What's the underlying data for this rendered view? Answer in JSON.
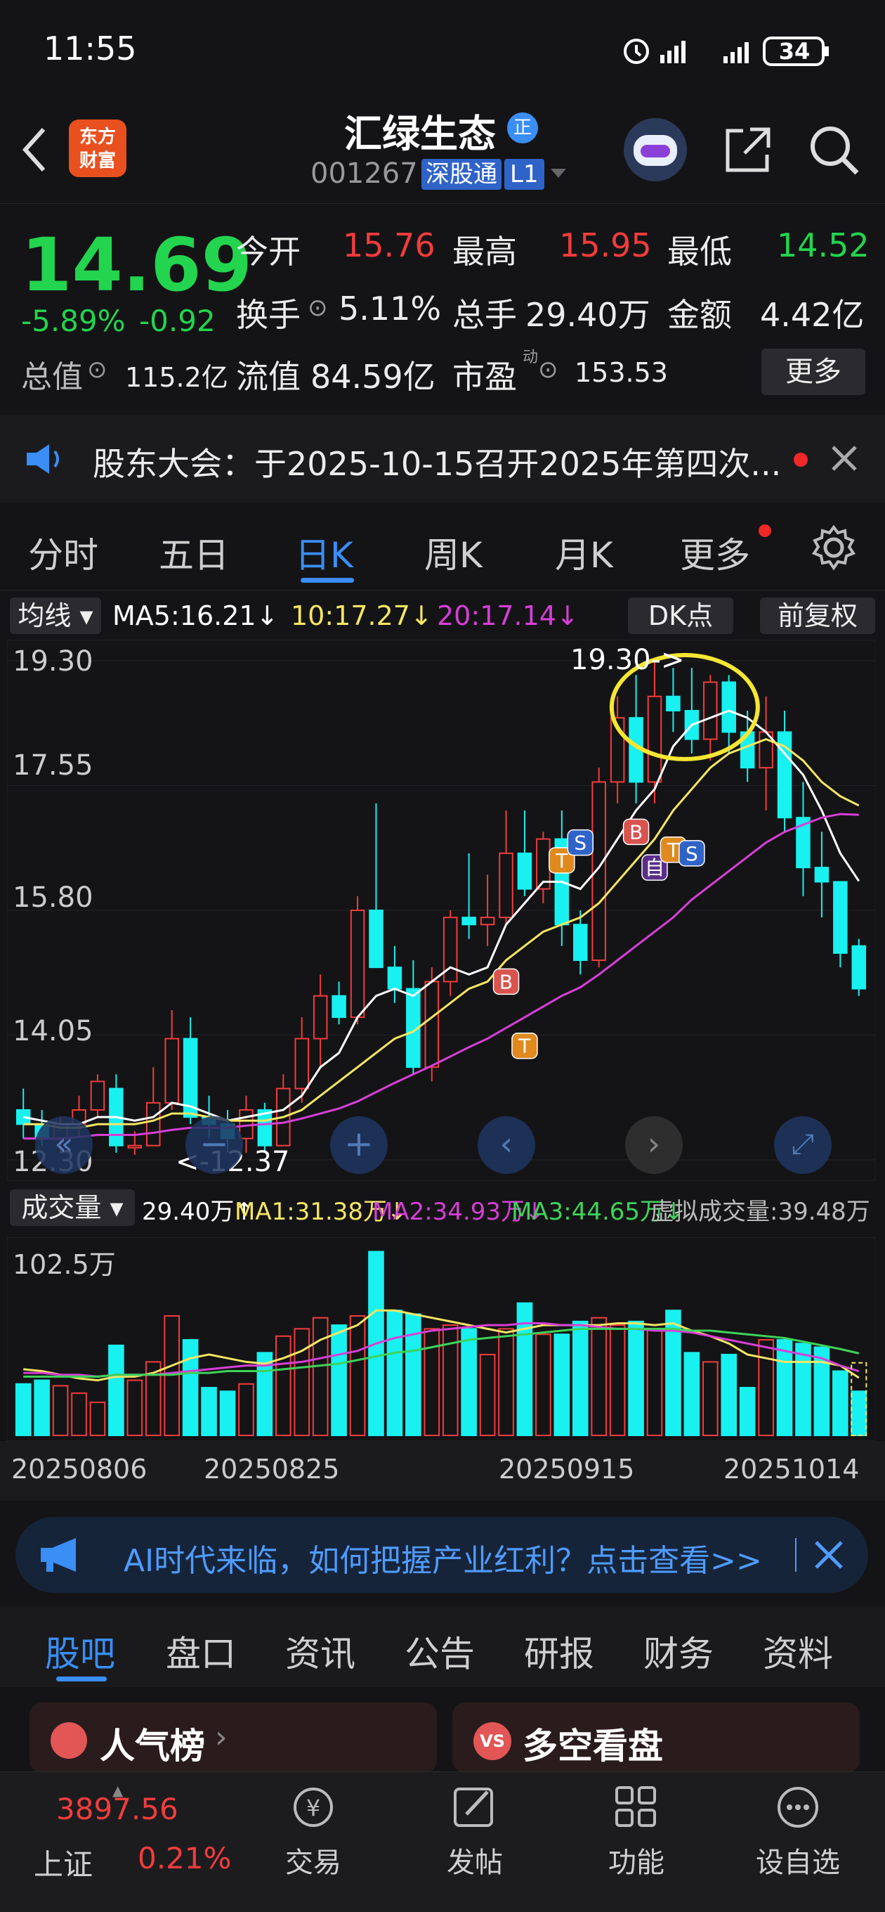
{
  "status": {
    "time": "11:55",
    "battery": "34"
  },
  "header": {
    "logo_line1": "东方",
    "logo_line2": "财富",
    "title": "汇绿生态",
    "title_badge": "正",
    "code": "001267",
    "tag_connect": "深股通",
    "tag_level": "L1"
  },
  "quote": {
    "price": "14.69",
    "change_pct": "-5.89%",
    "change_amt": "-0.92",
    "open_label": "今开",
    "open": "15.76",
    "high_label": "最高",
    "high": "15.95",
    "low_label": "最低",
    "low": "14.52",
    "turnover_label": "换手",
    "turnover": "5.11%",
    "volume_label": "总手",
    "volume": "29.40万",
    "amount_label": "金额",
    "amount": "4.42亿",
    "mktcap_label": "总值",
    "mktcap": "115.2亿",
    "float_label": "流值",
    "float_cap": "84.59亿",
    "pe_label": "市盈",
    "pe_sup": "动",
    "pe": "153.53",
    "more_button": "更多"
  },
  "notice": {
    "text": "股东大会：于2025-10-15召开2025年第四次..."
  },
  "ktabs": [
    "分时",
    "五日",
    "日K",
    "周K",
    "月K",
    "更多"
  ],
  "ktab_active": "日K",
  "chart_toolbar": {
    "ma_select": "均线",
    "ma5": "MA5:16.21↓",
    "ma10": "10:17.27↓",
    "ma20": "20:17.14↓",
    "dk_button": "DK点",
    "adjust_button": "前复权"
  },
  "price_axis": [
    "19.30",
    "17.55",
    "15.80",
    "14.05",
    "12.30"
  ],
  "annotations": {
    "high_marker": "19.30->",
    "low_marker": "<-12.37",
    "signal_b": "B",
    "signal_s": "S",
    "signal_t": "T",
    "signal_self": "自"
  },
  "volume_toolbar": {
    "select": "成交量",
    "vol": "29.40万↑",
    "ma1": "MA1:31.38万↓",
    "ma2": "MA2:34.93万↓",
    "ma3": "MA3:44.65万↓",
    "virtual": "虚拟成交量:39.48万"
  },
  "volume_axis_top": "102.5万",
  "date_axis": [
    "20250806",
    "20250825",
    "20250915",
    "20251014"
  ],
  "ad": {
    "text": "AI时代来临，如何把握产业红利？点击查看>>"
  },
  "subtabs": [
    "股吧",
    "盘口",
    "资讯",
    "公告",
    "研报",
    "财务",
    "资料"
  ],
  "subtab_active": "股吧",
  "cards": {
    "left": "人气榜",
    "right": "多空看盘",
    "right_icon": "VS"
  },
  "bottomnav": {
    "index_value": "3897.56",
    "index_name": "上证",
    "index_change": "0.21%",
    "items": [
      "交易",
      "发帖",
      "功能",
      "设自选"
    ]
  },
  "colors": {
    "up": "#f23c3c",
    "down": "#19f0f0",
    "ma5": "#ffffff",
    "ma10": "#f5e663",
    "ma20": "#d63fd6",
    "accent": "#3a8ef6"
  },
  "chart_data": {
    "type": "candlestick",
    "ylim": [
      12.3,
      19.3
    ],
    "candles": [
      {
        "o": 13.0,
        "h": 13.3,
        "l": 12.6,
        "c": 12.8
      },
      {
        "o": 12.8,
        "h": 13.0,
        "l": 12.5,
        "c": 12.6
      },
      {
        "o": 12.6,
        "h": 12.9,
        "l": 12.4,
        "c": 12.8
      },
      {
        "o": 12.8,
        "h": 13.2,
        "l": 12.6,
        "c": 13.0
      },
      {
        "o": 13.0,
        "h": 13.5,
        "l": 12.9,
        "c": 13.4
      },
      {
        "o": 13.3,
        "h": 13.5,
        "l": 12.4,
        "c": 12.5
      },
      {
        "o": 12.5,
        "h": 12.7,
        "l": 12.37,
        "c": 12.5
      },
      {
        "o": 12.5,
        "h": 13.6,
        "l": 12.5,
        "c": 13.1
      },
      {
        "o": 13.1,
        "h": 14.4,
        "l": 13.0,
        "c": 14.0
      },
      {
        "o": 14.0,
        "h": 14.3,
        "l": 12.8,
        "c": 12.9
      },
      {
        "o": 12.9,
        "h": 13.2,
        "l": 12.6,
        "c": 12.8
      },
      {
        "o": 12.8,
        "h": 13.0,
        "l": 12.4,
        "c": 12.6
      },
      {
        "o": 12.6,
        "h": 13.2,
        "l": 12.4,
        "c": 13.0
      },
      {
        "o": 13.0,
        "h": 13.1,
        "l": 12.4,
        "c": 12.5
      },
      {
        "o": 12.5,
        "h": 13.5,
        "l": 12.5,
        "c": 13.3
      },
      {
        "o": 13.3,
        "h": 14.3,
        "l": 13.1,
        "c": 14.0
      },
      {
        "o": 14.0,
        "h": 14.9,
        "l": 13.6,
        "c": 14.6
      },
      {
        "o": 14.6,
        "h": 14.8,
        "l": 14.2,
        "c": 14.3
      },
      {
        "o": 14.3,
        "h": 16.0,
        "l": 14.2,
        "c": 15.8
      },
      {
        "o": 15.8,
        "h": 17.3,
        "l": 15.0,
        "c": 15.0
      },
      {
        "o": 15.0,
        "h": 15.3,
        "l": 14.5,
        "c": 14.7
      },
      {
        "o": 14.7,
        "h": 15.1,
        "l": 13.5,
        "c": 13.6
      },
      {
        "o": 13.6,
        "h": 15.0,
        "l": 13.4,
        "c": 14.8
      },
      {
        "o": 14.8,
        "h": 15.8,
        "l": 14.6,
        "c": 15.7
      },
      {
        "o": 15.7,
        "h": 16.6,
        "l": 15.4,
        "c": 15.6
      },
      {
        "o": 15.6,
        "h": 16.3,
        "l": 15.3,
        "c": 15.7
      },
      {
        "o": 15.7,
        "h": 17.2,
        "l": 15.6,
        "c": 16.6
      },
      {
        "o": 16.6,
        "h": 17.2,
        "l": 16.0,
        "c": 16.1
      },
      {
        "o": 16.1,
        "h": 16.9,
        "l": 15.9,
        "c": 16.8
      },
      {
        "o": 16.8,
        "h": 17.2,
        "l": 15.3,
        "c": 15.6
      },
      {
        "o": 15.6,
        "h": 15.8,
        "l": 14.9,
        "c": 15.1
      },
      {
        "o": 15.1,
        "h": 17.8,
        "l": 15.0,
        "c": 17.6
      },
      {
        "o": 17.6,
        "h": 18.8,
        "l": 17.3,
        "c": 18.5
      },
      {
        "o": 18.5,
        "h": 19.1,
        "l": 17.3,
        "c": 17.6
      },
      {
        "o": 17.6,
        "h": 19.3,
        "l": 17.3,
        "c": 18.8
      },
      {
        "o": 18.8,
        "h": 19.2,
        "l": 18.3,
        "c": 18.6
      },
      {
        "o": 18.6,
        "h": 19.2,
        "l": 18.0,
        "c": 18.2
      },
      {
        "o": 18.2,
        "h": 19.1,
        "l": 17.9,
        "c": 19.0
      },
      {
        "o": 19.0,
        "h": 19.1,
        "l": 18.0,
        "c": 18.3
      },
      {
        "o": 18.3,
        "h": 18.6,
        "l": 17.6,
        "c": 17.8
      },
      {
        "o": 17.8,
        "h": 18.8,
        "l": 17.2,
        "c": 18.3
      },
      {
        "o": 18.3,
        "h": 18.6,
        "l": 16.9,
        "c": 17.1
      },
      {
        "o": 17.1,
        "h": 17.6,
        "l": 16.0,
        "c": 16.4
      },
      {
        "o": 16.4,
        "h": 16.9,
        "l": 15.7,
        "c": 16.2
      },
      {
        "o": 16.2,
        "h": 16.2,
        "l": 15.0,
        "c": 15.2
      },
      {
        "o": 15.3,
        "h": 15.4,
        "l": 14.6,
        "c": 14.7
      }
    ],
    "ma5": [
      12.9,
      12.85,
      12.8,
      12.8,
      12.9,
      12.9,
      12.85,
      12.9,
      13.1,
      13.05,
      12.95,
      12.85,
      12.9,
      12.95,
      13.0,
      13.2,
      13.6,
      13.8,
      14.3,
      14.6,
      14.7,
      14.6,
      14.8,
      15.0,
      14.9,
      15.0,
      15.6,
      15.9,
      16.2,
      16.2,
      16.1,
      16.4,
      16.8,
      17.2,
      17.5,
      18.1,
      18.4,
      18.5,
      18.6,
      18.5,
      18.3,
      18.0,
      17.7,
      17.2,
      16.6,
      16.21
    ],
    "ma10": [
      12.8,
      12.8,
      12.75,
      12.75,
      12.8,
      12.8,
      12.8,
      12.85,
      12.95,
      12.95,
      12.9,
      12.85,
      12.85,
      12.85,
      12.9,
      13.0,
      13.2,
      13.4,
      13.6,
      13.8,
      14.0,
      14.1,
      14.3,
      14.5,
      14.7,
      14.8,
      15.1,
      15.3,
      15.5,
      15.6,
      15.7,
      15.9,
      16.2,
      16.5,
      16.8,
      17.2,
      17.5,
      17.8,
      18.0,
      18.1,
      18.2,
      18.1,
      17.9,
      17.6,
      17.4,
      17.27
    ],
    "ma20": [
      12.6,
      12.6,
      12.6,
      12.62,
      12.65,
      12.65,
      12.65,
      12.68,
      12.72,
      12.75,
      12.75,
      12.75,
      12.78,
      12.8,
      12.82,
      12.88,
      12.95,
      13.02,
      13.12,
      13.25,
      13.38,
      13.5,
      13.62,
      13.75,
      13.88,
      14.0,
      14.15,
      14.3,
      14.45,
      14.6,
      14.72,
      14.9,
      15.1,
      15.3,
      15.5,
      15.7,
      15.95,
      16.15,
      16.35,
      16.55,
      16.75,
      16.9,
      17.0,
      17.1,
      17.15,
      17.14
    ],
    "volumes": [
      28,
      30,
      27,
      23,
      18,
      49,
      30,
      40,
      65,
      52,
      26,
      24,
      28,
      45,
      54,
      58,
      64,
      60,
      65,
      100,
      68,
      66,
      58,
      60,
      58,
      44,
      58,
      72,
      55,
      55,
      62,
      64,
      60,
      62,
      58,
      68,
      45,
      40,
      44,
      26,
      52,
      52,
      50,
      48,
      35,
      24
    ],
    "vol_ma1": [
      36,
      35,
      33,
      31,
      30,
      32,
      32,
      34,
      38,
      42,
      44,
      42,
      40,
      39,
      42,
      46,
      52,
      56,
      60,
      68,
      68,
      66,
      64,
      62,
      60,
      58,
      56,
      58,
      60,
      60,
      60,
      60,
      61,
      61,
      60,
      61,
      57,
      54,
      50,
      44,
      42,
      40,
      40,
      40,
      38,
      31.38
    ],
    "vol_ma2": [
      34,
      34,
      33,
      33,
      32,
      33,
      33,
      33,
      34,
      35,
      36,
      37,
      38,
      38,
      39,
      40,
      42,
      44,
      46,
      50,
      53,
      55,
      57,
      58,
      59,
      60,
      60,
      61,
      61,
      60,
      60,
      59,
      58,
      58,
      57,
      57,
      56,
      54,
      52,
      50,
      48,
      46,
      44,
      42,
      38,
      34.93
    ],
    "vol_ma3": [
      32,
      32,
      32,
      32,
      32,
      33,
      33,
      33,
      33,
      34,
      34,
      35,
      35,
      35,
      36,
      37,
      38,
      39,
      41,
      43,
      45,
      46,
      48,
      50,
      52,
      53,
      54,
      55,
      56,
      57,
      58,
      58,
      58,
      58,
      58,
      58,
      57,
      57,
      56,
      55,
      54,
      53,
      51,
      49,
      47,
      44.65
    ],
    "vol_ylim": [
      0,
      102.5
    ]
  }
}
